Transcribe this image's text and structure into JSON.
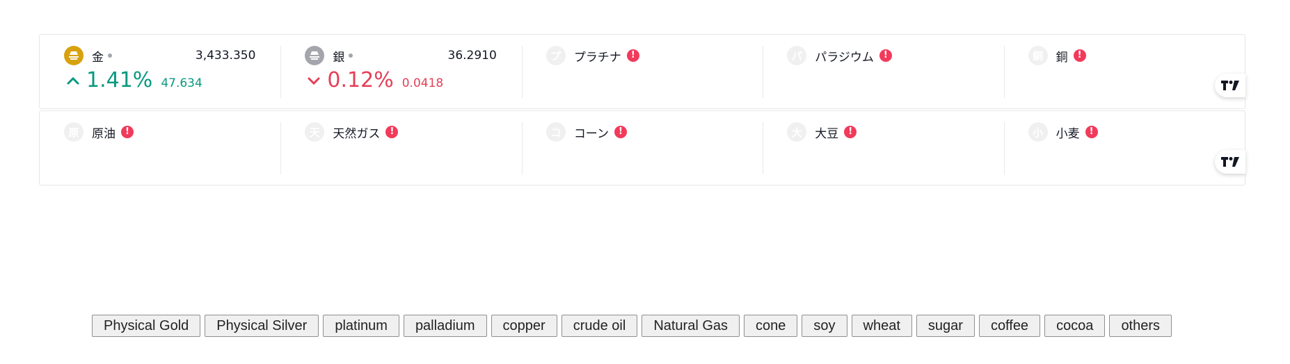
{
  "colors": {
    "up": "#089981",
    "down": "#e53f56",
    "warning": "#f23a5b",
    "gold": "#d8a10e",
    "silver": "#a5a5ad"
  },
  "rows": [
    [
      {
        "name": "金",
        "price": "3,433.350",
        "change_pct": "1.41%",
        "change_abs": "47.634",
        "direction": "up",
        "icon": "gold-bar-icon"
      },
      {
        "name": "銀",
        "price": "36.2910",
        "change_pct": "0.12%",
        "change_abs": "0.0418",
        "direction": "down",
        "icon": "silver-bar-icon"
      },
      {
        "name": "プラチナ",
        "letter": "プ",
        "error": true
      },
      {
        "name": "パラジウム",
        "letter": "パ",
        "error": true
      },
      {
        "name": "銅",
        "letter": "銅",
        "error": true
      }
    ],
    [
      {
        "name": "原油",
        "letter": "原",
        "error": true
      },
      {
        "name": "天然ガス",
        "letter": "天",
        "error": true
      },
      {
        "name": "コーン",
        "letter": "コ",
        "error": true
      },
      {
        "name": "大豆",
        "letter": "大",
        "error": true
      },
      {
        "name": "小麦",
        "letter": "小",
        "error": true
      }
    ]
  ],
  "warning_glyph": "!",
  "buttons": [
    "Physical Gold",
    "Physical Silver",
    "platinum",
    "palladium",
    "copper",
    "crude oil",
    "Natural Gas",
    "cone",
    "soy",
    "wheat",
    "sugar",
    "coffee",
    "cocoa",
    "others"
  ]
}
